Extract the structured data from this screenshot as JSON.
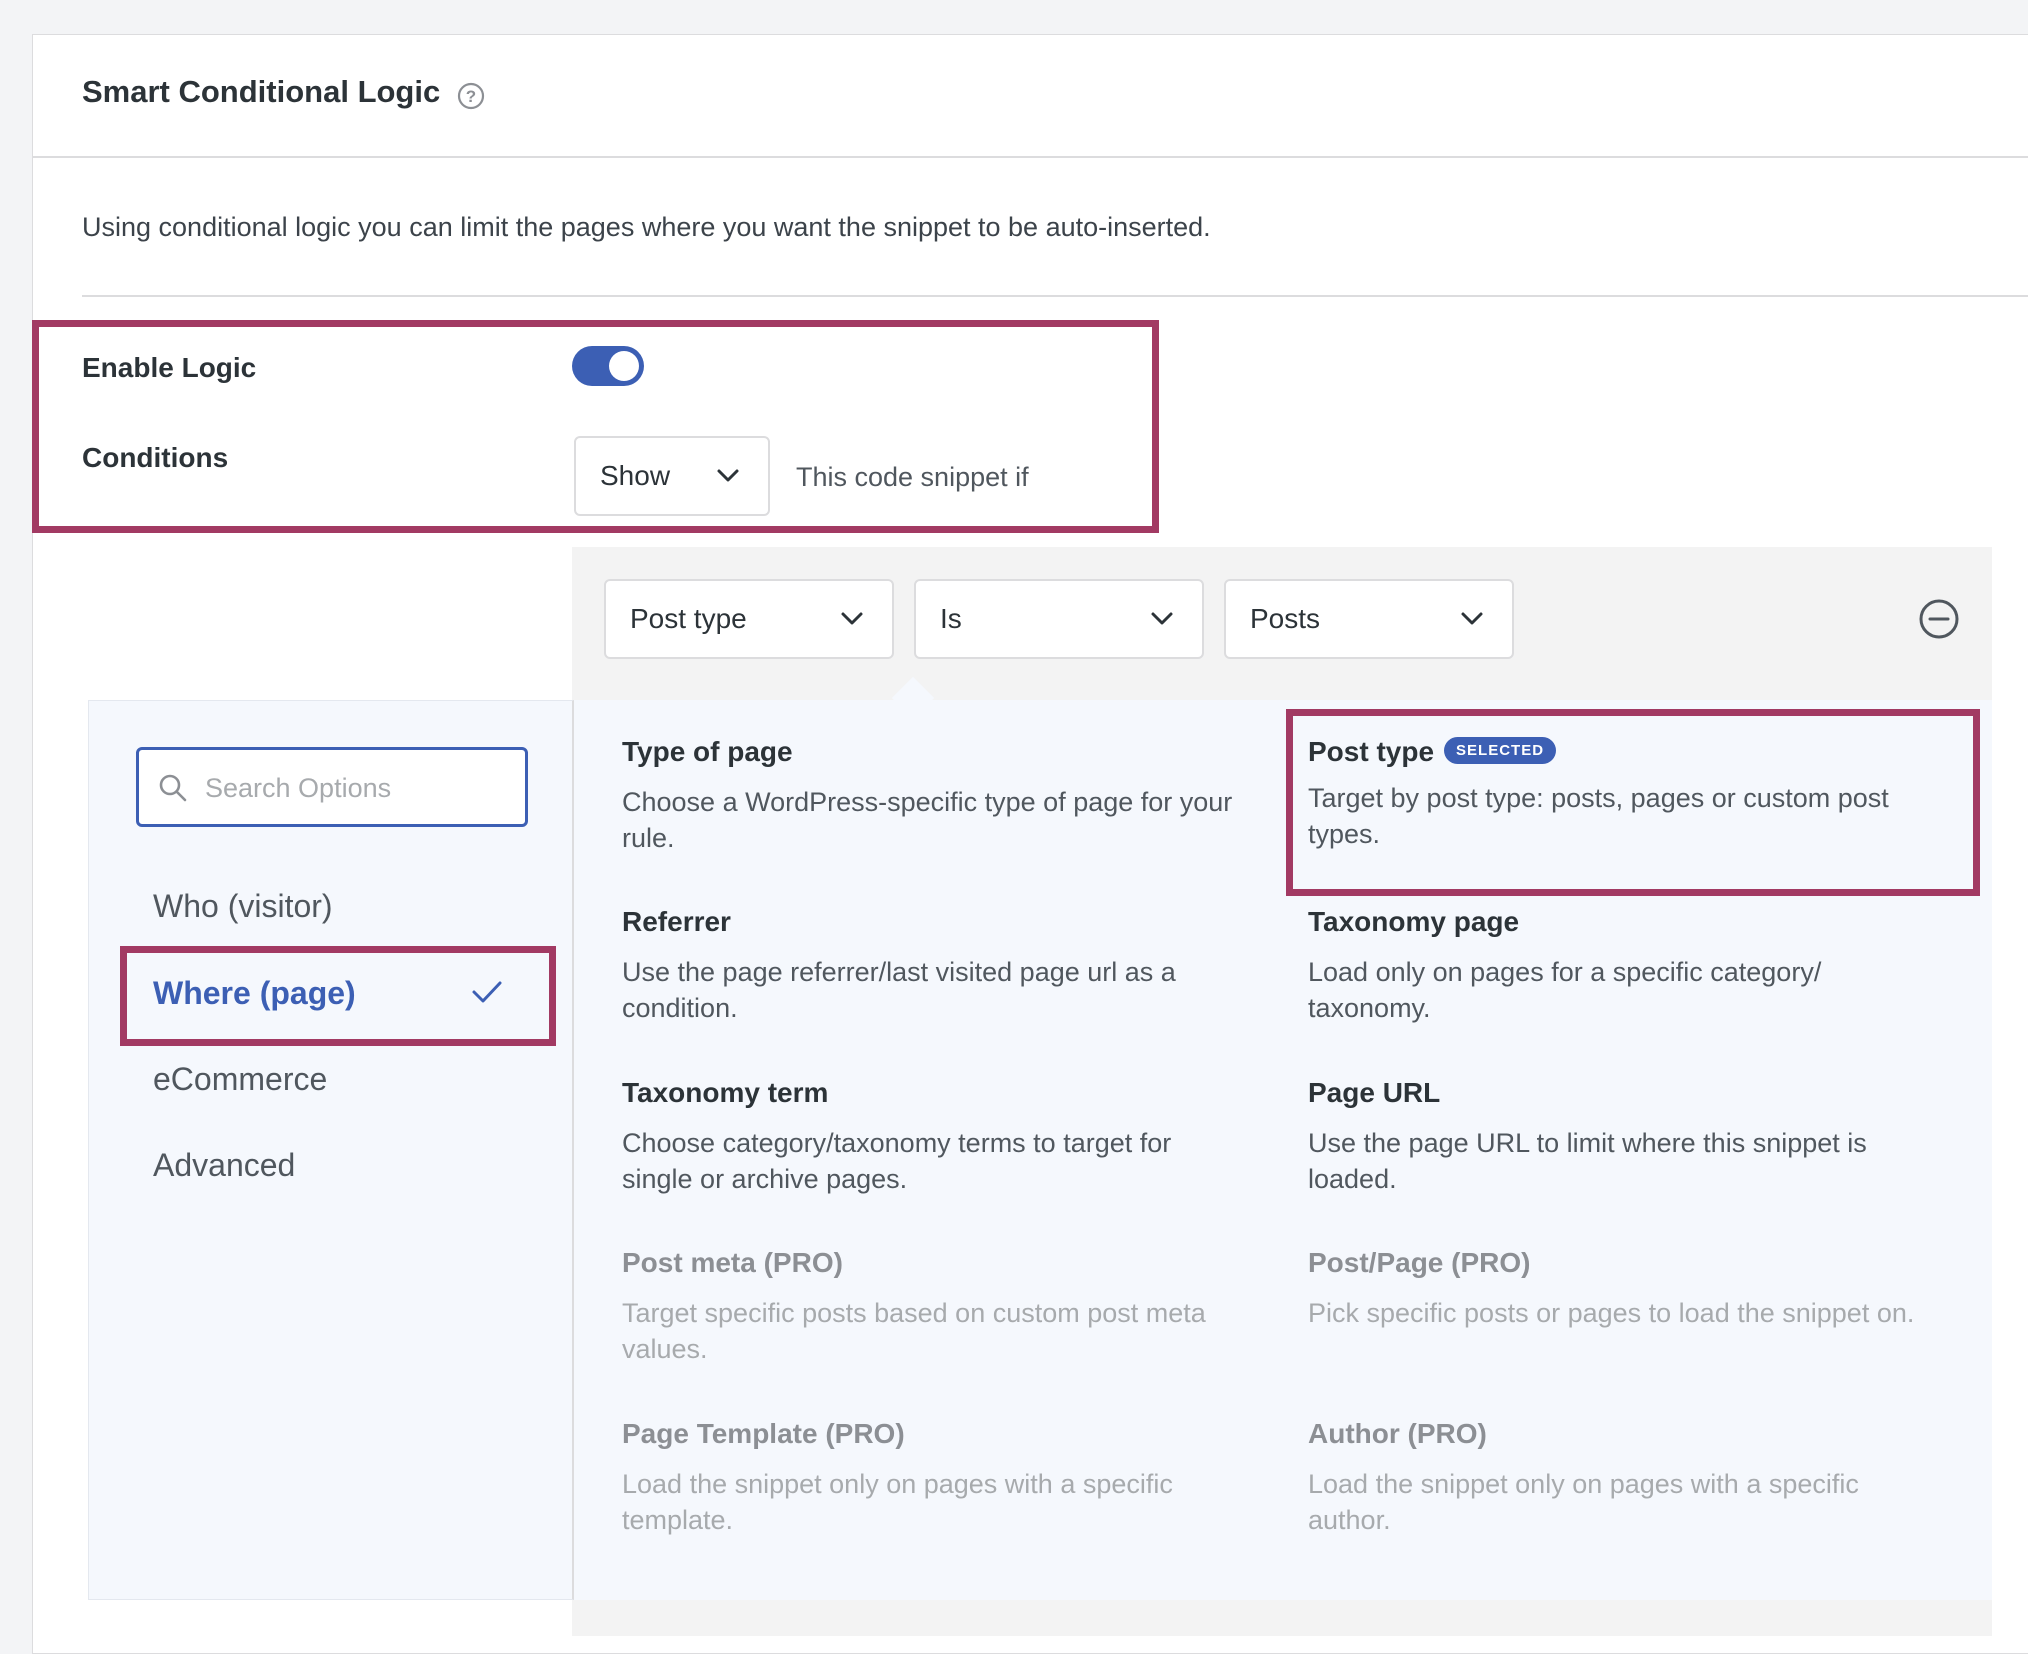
{
  "panel": {
    "title": "Smart Conditional Logic",
    "help_icon": "question-circle-icon",
    "intro": "Using conditional logic you can limit the pages where you want the snippet to be auto-inserted."
  },
  "enable_logic": {
    "label": "Enable Logic",
    "enabled": true
  },
  "conditions": {
    "label": "Conditions",
    "action_value": "Show",
    "suffix": "This code snippet if"
  },
  "rule": {
    "field": "Post type",
    "operator": "Is",
    "value": "Posts",
    "remove_icon": "minus-circle-icon"
  },
  "dropdown": {
    "search_placeholder": "Search Options",
    "categories": [
      "Who (visitor)",
      "Where (page)",
      "eCommerce",
      "Advanced"
    ],
    "active_category": "Where (page)",
    "options": [
      {
        "title": "Type of page",
        "desc": "Choose a WordPress-specific type of page for your rule."
      },
      {
        "title": "Post type",
        "desc": "Target by post type: posts, pages or custom post types.",
        "badge": "SELECTED"
      },
      {
        "title": "Referrer",
        "desc": "Use the page referrer/last visited page url as a condition."
      },
      {
        "title": "Taxonomy page",
        "desc": "Load only on pages for a specific category/ taxonomy."
      },
      {
        "title": "Taxonomy term",
        "desc": "Choose category/taxonomy terms to target for single or archive pages."
      },
      {
        "title": "Page URL",
        "desc": "Use the page URL to limit where this snippet is loaded."
      },
      {
        "title": "Post meta (PRO)",
        "desc": "Target specific posts based on custom post meta values."
      },
      {
        "title": "Post/Page (PRO)",
        "desc": "Pick specific posts or pages to load the snippet on."
      },
      {
        "title": "Page Template (PRO)",
        "desc": "Load the snippet only on pages with a specific template."
      },
      {
        "title": "Author (PRO)",
        "desc": "Load the snippet only on pages with a specific author."
      }
    ]
  },
  "colors": {
    "accent": "#3c5fb4",
    "highlight": "#a23a63"
  }
}
